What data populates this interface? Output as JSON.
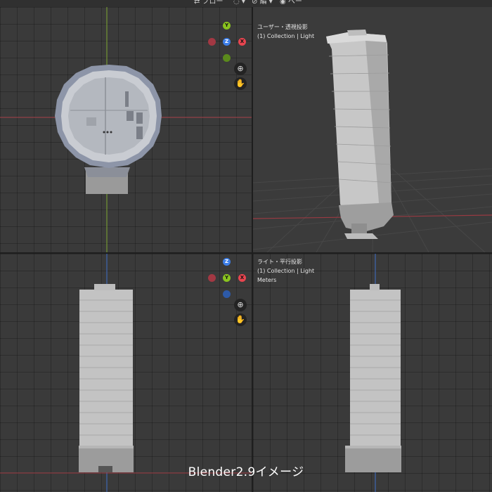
{
  "topbar": {
    "item1": "⇄ フロー",
    "item2": "◌ ▾",
    "item3": "⊘ 編 ▾",
    "item4": "◉ ペー"
  },
  "viewports": {
    "top_left": {
      "gizmo": {
        "y": "Y",
        "z": "Z",
        "x": "X"
      }
    },
    "top_right": {
      "title": "ユーザー・透視投影",
      "collection": "(1) Collection | Light"
    },
    "bottom_left": {
      "title": "ライト・平行投影",
      "collection": "(1) Collection | Light",
      "units": "Meters",
      "gizmo": {
        "y": "Y",
        "z": "Z",
        "x": "X"
      }
    }
  },
  "tools": {
    "zoom_icon": "zoom-icon",
    "hand_icon": "hand-icon"
  },
  "colors": {
    "x_axis": "#e8454f",
    "y_axis": "#8ac41f",
    "z_axis": "#3d7ee8"
  },
  "caption": "Blender2.9イメージ"
}
